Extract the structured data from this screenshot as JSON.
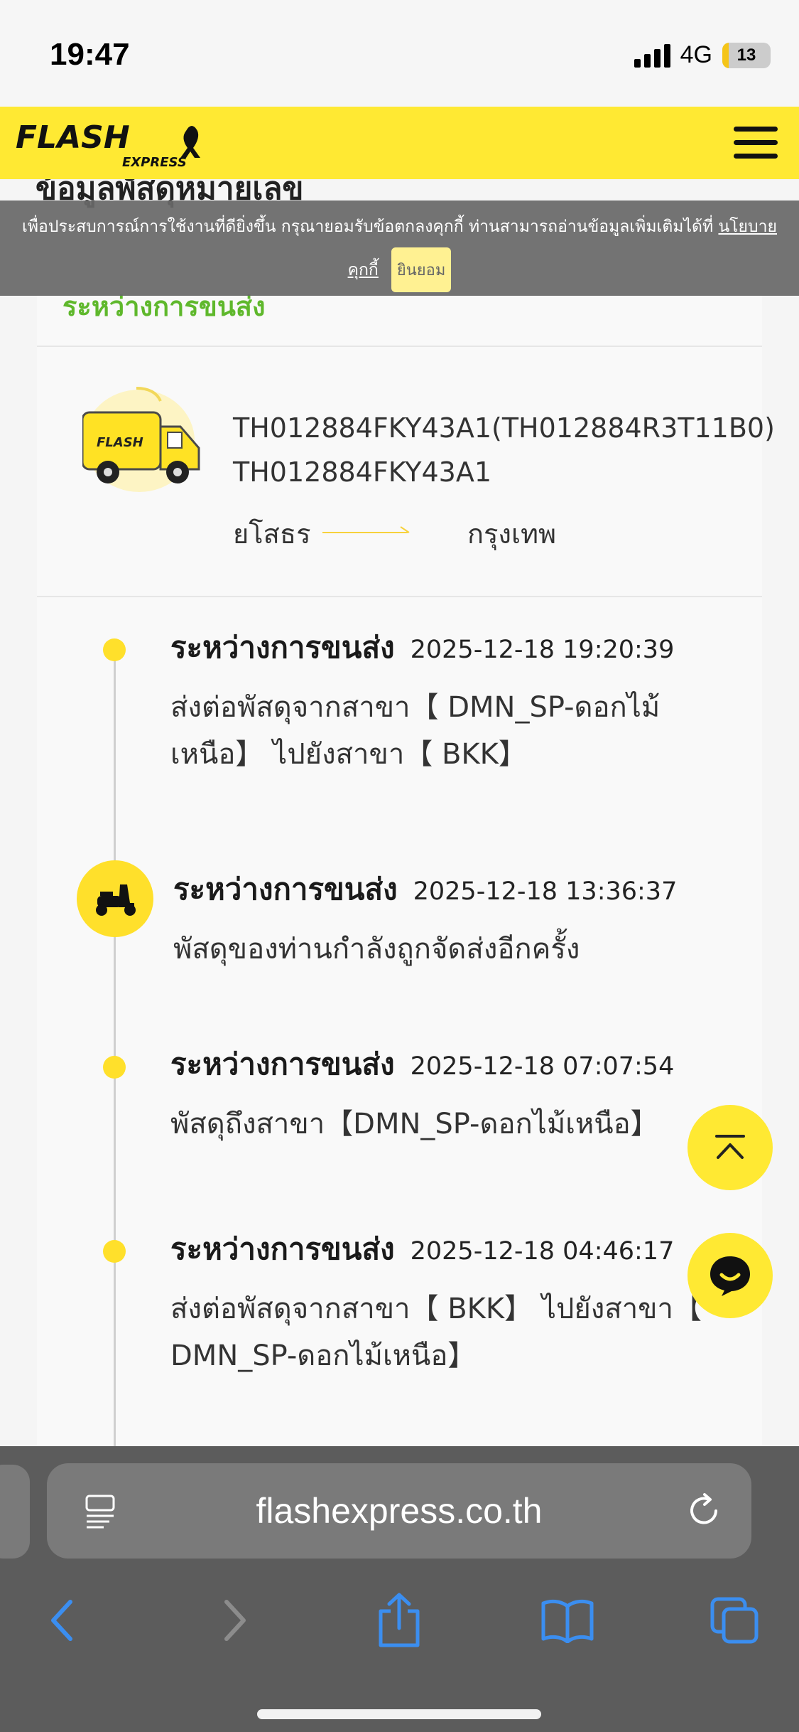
{
  "status_bar": {
    "time": "19:47",
    "network": "4G",
    "battery": "13",
    "battery_level_percent": 13
  },
  "header": {
    "logo_text": "FLASH",
    "logo_sub": "EXPRESS",
    "menu_icon": "hamburger-icon",
    "ribbon_icon": "ribbon-icon",
    "brand_color": "#ffe933"
  },
  "page_title_peek": "ข้อมูลพัสดุหมายเลข",
  "cookie_banner": {
    "text": "เพื่อประสบการณ์การใช้งานที่ดียิ่งขึ้น กรุณายอมรับข้อตกลงคุกกี้ ท่านสามารถอ่านข้อมูลเพิ่มเติมได้ที่",
    "policy_link_1": "นโยบาย",
    "policy_link_2": "คุกกี้",
    "accept_label": "ยินยอม"
  },
  "parcel": {
    "status": "ระหว่างการขนส่ง",
    "status_color": "#5fb82c",
    "tracking_main": "TH012884FKY43A1(TH012884R3T11B0)",
    "tracking_sub": "TH012884FKY43A1",
    "origin": "ยโสธร",
    "destination": "กรุงเทพ"
  },
  "timeline": [
    {
      "status": "ระหว่างการขนส่ง",
      "datetime": "2025-12-18 19:20:39",
      "desc_line1": "ส่งต่อพัสดุจากสาขา【 DMN_SP-ดอกไม้",
      "desc_line2": "เหนือ】 ไปยังสาขา【 BKK】"
    },
    {
      "status": "ระหว่างการขนส่ง",
      "datetime": "2025-12-18 13:36:37",
      "desc_line1": "พัสดุของท่านกำลังถูกจัดส่งอีกครั้ง",
      "icon": "scooter-icon"
    },
    {
      "status": "ระหว่างการขนส่ง",
      "datetime": "2025-12-18 07:07:54",
      "desc_line1": "พัสดุถึงสาขา【DMN_SP-ดอกไม้เหนือ】"
    },
    {
      "status": "ระหว่างการขนส่ง",
      "datetime": "2025-12-18 04:46:17",
      "desc_line1": "ส่งต่อพัสดุจากสาขา【 BKK】 ไปยังสาขา【",
      "desc_line2": "DMN_SP-ดอกไม้เหนือ】"
    }
  ],
  "floating_buttons": {
    "scroll_top_icon": "chevron-up-icon",
    "chat_icon": "chat-icon"
  },
  "safari": {
    "url": "flashexpress.co.th",
    "icons": [
      "back-icon",
      "forward-icon",
      "share-icon",
      "bookmarks-icon",
      "tabs-icon"
    ]
  }
}
